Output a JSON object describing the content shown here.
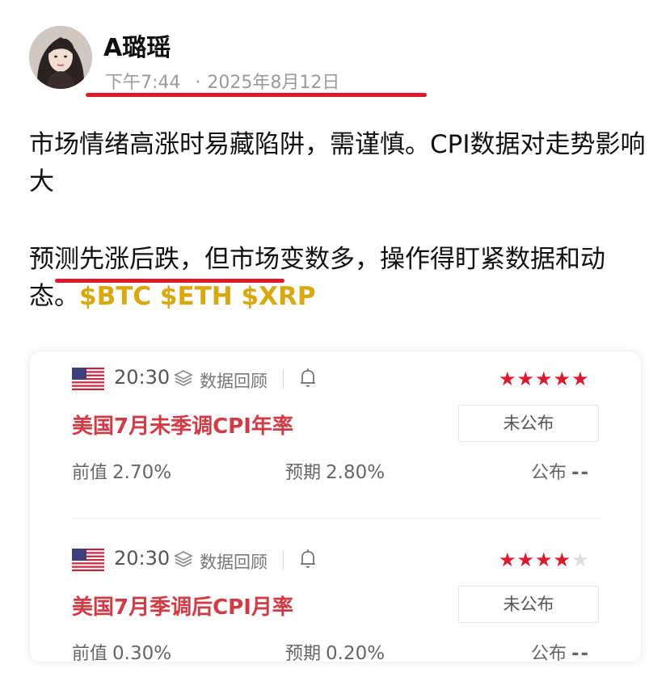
{
  "post": {
    "author": "A璐瑶",
    "time": "下午7:44",
    "separator": "·",
    "date": "2025年8月12日",
    "paragraph1": "市场情绪高涨时易藏陷阱，需谨慎。CPI数据对走势影响大",
    "paragraph2_text": "预测先涨后跌，但市场变数多，操作得盯紧数据和动态。",
    "tickers": "$BTC $ETH $XRP"
  },
  "colors": {
    "accent_red": "#e0182b",
    "ticker_gold": "#d9a80d",
    "event_title": "#d23b44"
  },
  "events": [
    {
      "flag": "us-flag",
      "time": "20:30",
      "review_label": "数据回顾",
      "stars_on": 5,
      "stars_total": 5,
      "star_on_1": "★★★★★",
      "star_off_1": "",
      "title": "美国7月未季调CPI年率",
      "status": "未公布",
      "prev_label": "前值",
      "prev_value": "2.70%",
      "forecast_label": "预期",
      "forecast_value": "2.80%",
      "published_label": "公布",
      "published_value": "--"
    },
    {
      "flag": "us-flag",
      "time": "20:30",
      "review_label": "数据回顾",
      "stars_on": 4,
      "stars_total": 5,
      "star_on_1": "★★★★",
      "star_off_1": "★",
      "title": "美国7月季调后CPI月率",
      "status": "未公布",
      "prev_label": "前值",
      "prev_value": "0.30%",
      "forecast_label": "预期",
      "forecast_value": "0.20%",
      "published_label": "公布",
      "published_value": "--"
    }
  ]
}
